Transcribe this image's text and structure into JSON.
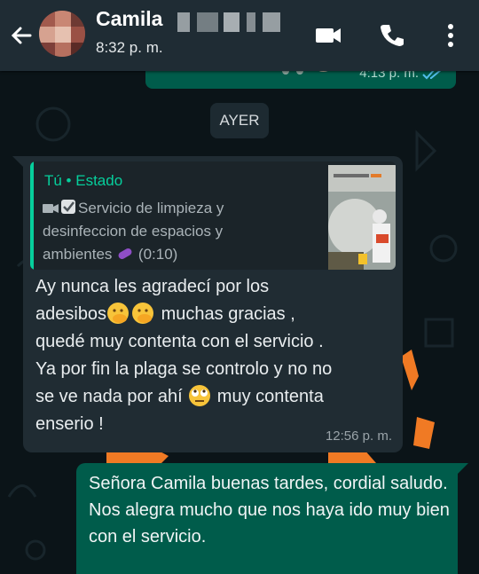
{
  "header": {
    "contact_name": "Camila",
    "last_seen": "8:32 p. m.",
    "icons": [
      "back-arrow-icon",
      "video-call-icon",
      "voice-call-icon",
      "more-options-icon"
    ]
  },
  "chat": {
    "previous_message_time": "4:13 p. m.",
    "day_separator": "AYER",
    "incoming": {
      "quote_author": "Tú • Estado",
      "quote_text": "Servicio de limpieza y desinfeccion de espacios y ambientes",
      "quote_duration": "(0:10)",
      "text_line1": "Ay nunca les agradecí por los",
      "text_line2a": "adesibos",
      "text_line2b": " muchas gracias ,",
      "text_line3": "quedé muy contenta con el servicio .",
      "text_line4": "Ya por fin la plaga se controlo y no no",
      "text_line5a": "se ve nada por ahí ",
      "text_line5b": " muy contenta",
      "text_line6": "enserio !",
      "time": "12:56 p. m."
    },
    "outgoing": {
      "text": "Señora Camila buenas tardes, cordial saludo.\nNos alegra mucho que nos haya ido muy bien con el servicio."
    }
  },
  "colors": {
    "header_bg": "#1f2c34",
    "chat_bg": "#0b1418",
    "incoming_bubble": "#202c33",
    "outgoing_bubble": "#005c4b",
    "accent": "#06cf9c"
  }
}
